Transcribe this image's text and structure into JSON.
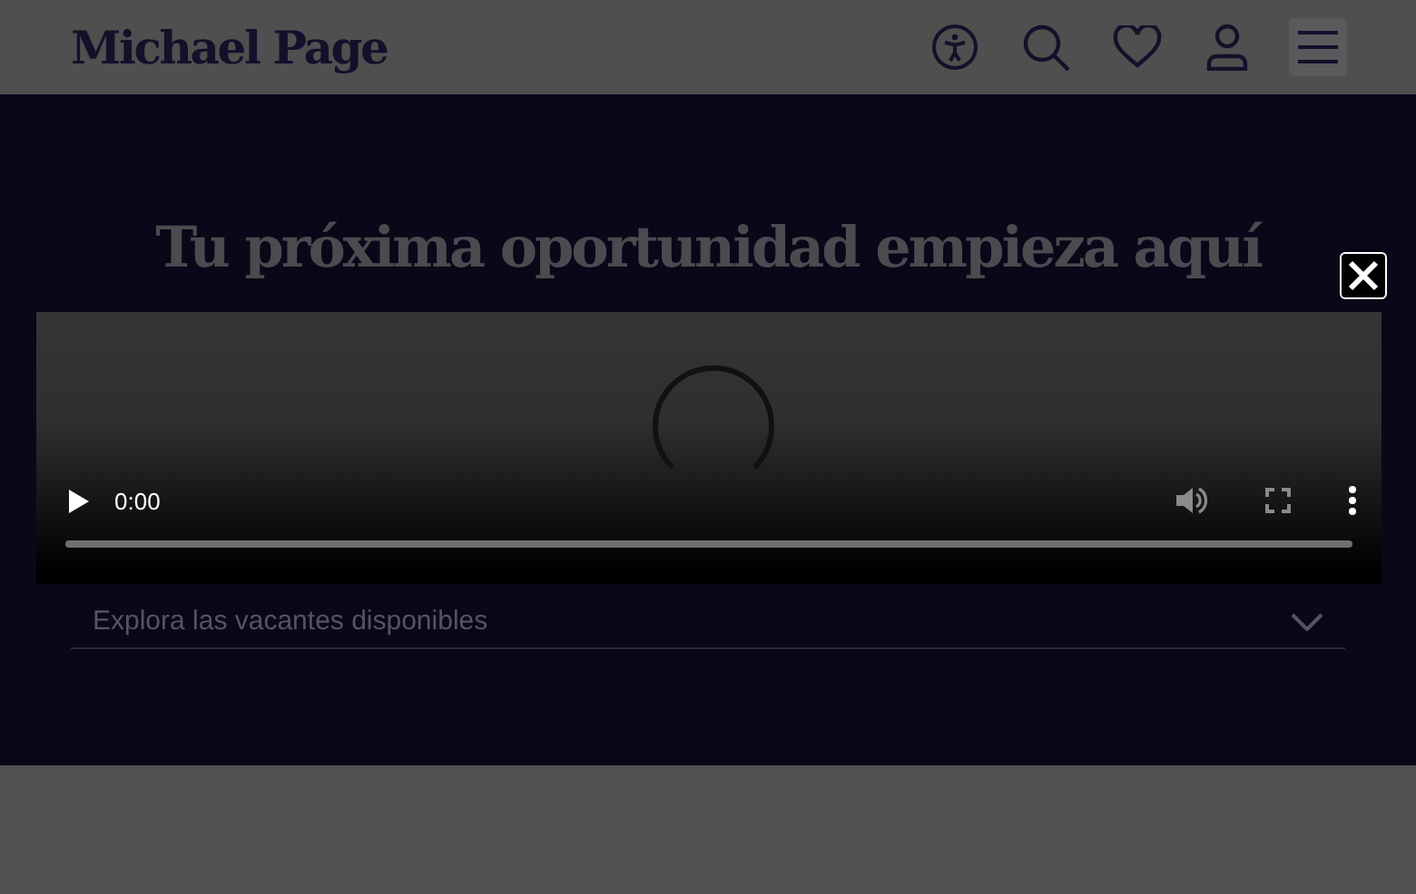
{
  "header": {
    "logo": "Michael Page"
  },
  "hero": {
    "title": "Tu próxima oportunidad empieza aquí",
    "search": {
      "placeholder": "Explora las vacantes disponibles"
    }
  },
  "video": {
    "time": "0:00",
    "level": 0
  }
}
